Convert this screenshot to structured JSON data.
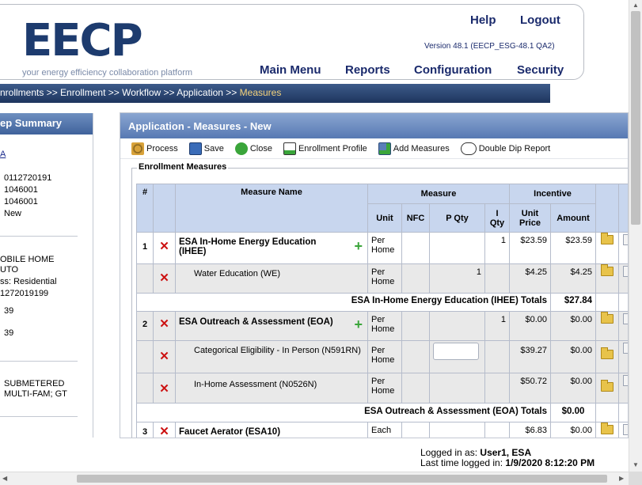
{
  "header": {
    "logo_text": "EECP",
    "tagline": "your energy efficiency collaboration platform",
    "help": "Help",
    "logout": "Logout",
    "version": "Version 48.1 (EECP_ESG-48.1 QA2)",
    "nav": [
      "Main Menu",
      "Reports",
      "Configuration",
      "Security"
    ]
  },
  "breadcrumb": {
    "items": [
      "nrollments",
      "Enrollment",
      "Workflow",
      "Application"
    ],
    "sep": " >> ",
    "current": "Measures"
  },
  "left_panel": {
    "title": "ep Summary",
    "items": [
      "A",
      "0112720191",
      "1046001",
      "1046001",
      "New",
      "OBILE HOME",
      "UTO",
      "ss: Residential",
      "1272019199",
      "39",
      "39",
      "SUBMETERED",
      "MULTI-FAM; GT"
    ]
  },
  "main": {
    "title": "Application - Measures - New",
    "toolbar": [
      {
        "label": "Process",
        "icon": "process-gears-icon"
      },
      {
        "label": "Save",
        "icon": "save-disk-icon"
      },
      {
        "label": "Close",
        "icon": "close-arrow-icon"
      },
      {
        "label": "Enrollment Profile",
        "icon": "enrollment-profile-icon"
      },
      {
        "label": "Add Measures",
        "icon": "add-measures-icon"
      },
      {
        "label": "Double Dip Report",
        "icon": "double-dip-report-icon"
      }
    ],
    "fieldset_legend": "Enrollment Measures",
    "table": {
      "headers": {
        "num": "#",
        "name": "Measure Name",
        "measure": "Measure",
        "incentive": "Incentive",
        "unit": "Unit",
        "nfc": "NFC",
        "pqty": "P Qty",
        "iqty": "I Qty",
        "unit_price": "Unit Price",
        "amount": "Amount"
      },
      "rows": [
        {
          "num": "1",
          "name": "ESA In-Home Energy Education (IHEE)",
          "unit": "Per Home",
          "nfc": "",
          "pqty": "",
          "iqty": "1",
          "unit_price": "$23.59",
          "amount": "$23.59"
        },
        {
          "name": "Water Education (WE)",
          "unit": "Per Home",
          "nfc": "",
          "pqty": "1",
          "iqty": "",
          "unit_price": "$4.25",
          "amount": "$4.25"
        },
        {
          "total_label": "ESA In-Home Energy Education (IHEE) Totals",
          "total": "$27.84"
        },
        {
          "num": "2",
          "name": "ESA Outreach & Assessment (EOA)",
          "unit": "Per Home",
          "nfc": "",
          "pqty": "",
          "iqty": "1",
          "unit_price": "$0.00",
          "amount": "$0.00"
        },
        {
          "name": "Categorical Eligibility - In Person (N591RN)",
          "unit": "Per Home",
          "nfc": "",
          "pqty": "",
          "iqty": "",
          "unit_price": "$39.27",
          "amount": "$0.00"
        },
        {
          "name": "In-Home Assessment (N0526N)",
          "unit": "Per Home",
          "nfc": "",
          "pqty": "",
          "iqty": "",
          "unit_price": "$50.72",
          "amount": "$0.00"
        },
        {
          "total_label": "ESA Outreach & Assessment (EOA) Totals",
          "total": "$0.00"
        },
        {
          "num": "3",
          "name": "Faucet Aerator (ESA10)",
          "unit": "Each",
          "nfc": "",
          "pqty": "",
          "iqty": "",
          "unit_price": "$6.83",
          "amount": "$0.00"
        }
      ]
    }
  },
  "footer": {
    "logged_in_label": "Logged in as:",
    "logged_in_user": "User1, ESA",
    "last_time_label": "Last time logged in:",
    "last_time_value": "1/9/2020 8:12:20 PM"
  }
}
